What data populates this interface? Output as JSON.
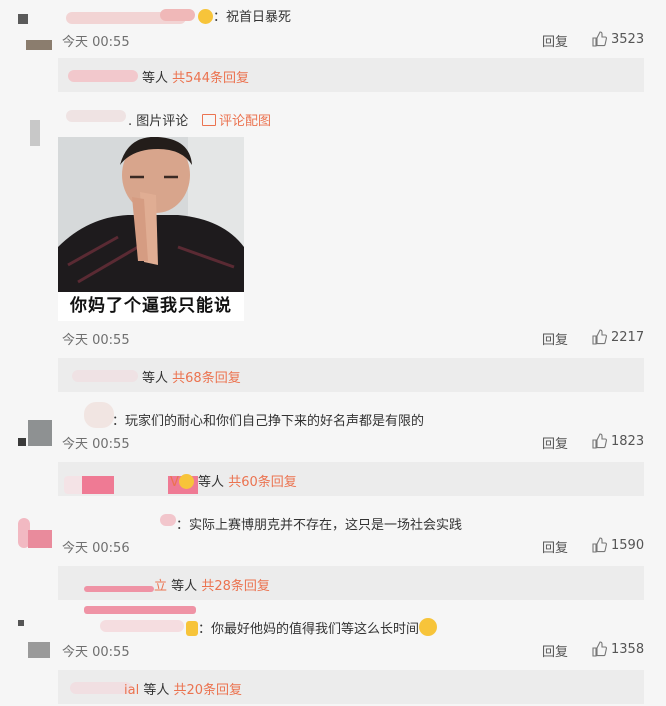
{
  "comments": [
    {
      "text": "：祝首日暴死",
      "time": "今天 00:55",
      "reply_label": "回复",
      "likes": "3523",
      "sub_replies": {
        "suffix": "等人",
        "count_label": "共544条回复"
      }
    },
    {
      "text": "图片评论",
      "image_link": "评论配图",
      "image_caption": "你妈了个逼我只能说",
      "time": "今天 00:55",
      "reply_label": "回复",
      "likes": "2217",
      "sub_replies": {
        "suffix": "等人",
        "count_label": "共68条回复"
      }
    },
    {
      "text": "：玩家们的耐心和你们自己挣下来的好名声都是有限的",
      "time": "今天 00:55",
      "reply_label": "回复",
      "likes": "1823",
      "sub_replies": {
        "suffix": "等人",
        "count_label": "共60条回复"
      }
    },
    {
      "text": "：实际上赛博朋克并不存在，这只是一场社会实践",
      "time": "今天 00:56",
      "reply_label": "回复",
      "likes": "1590",
      "sub_replies": {
        "name_tail": "立",
        "suffix": "等人",
        "count_label": "共28条回复"
      }
    },
    {
      "text": "：你最好他妈的值得我们等这么长时间",
      "time": "今天 00:55",
      "reply_label": "回复",
      "likes": "1358",
      "sub_replies": {
        "name_tail": "ial",
        "suffix": "等人",
        "count_label": "共20条回复"
      }
    }
  ],
  "colors": {
    "accent": "#eb7350",
    "background": "#f6f6f6",
    "reply_bar": "#ececec"
  }
}
